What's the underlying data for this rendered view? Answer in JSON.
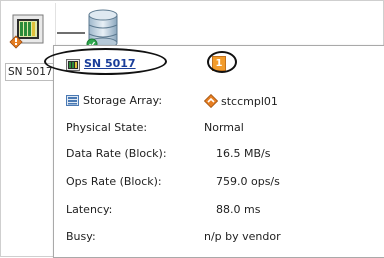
{
  "topology": {
    "node_label": "SN 5017"
  },
  "tooltip": {
    "title": "SN 5017",
    "badge_count": "1",
    "rows": [
      {
        "label": "Storage Array:",
        "value": "stccmpl01"
      },
      {
        "label": "Physical State:",
        "value": "Normal"
      },
      {
        "label": "Data Rate (Block):",
        "value": "16.5 MB/s"
      },
      {
        "label": "Ops Rate (Block):",
        "value": "759.0 ops/s"
      },
      {
        "label": "Latency:",
        "value": "88.0 ms"
      },
      {
        "label": "Busy:",
        "value": "n/p by vendor"
      }
    ]
  },
  "colors": {
    "link": "#1a3e9a",
    "badge": "#f39c2b",
    "warning": "#e67e22"
  }
}
